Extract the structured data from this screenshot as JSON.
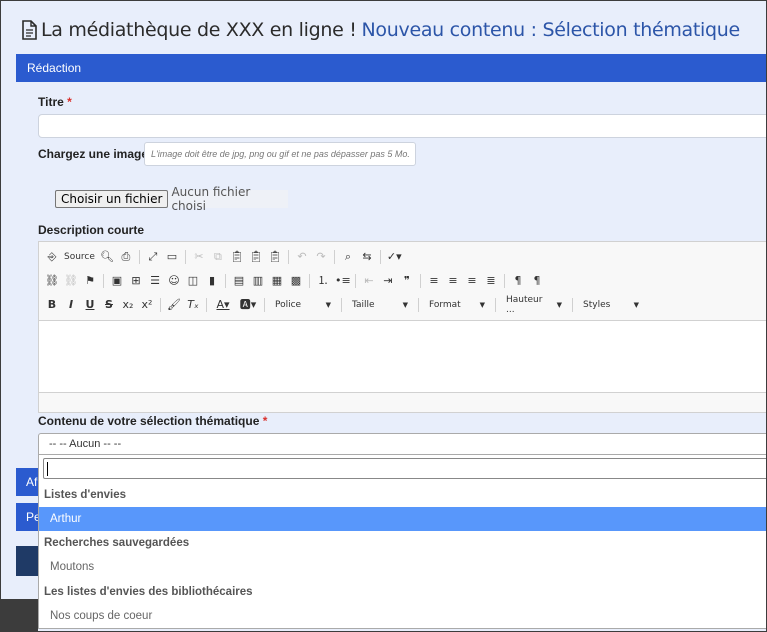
{
  "header": {
    "site_title": "La médiathèque de XXX en ligne !",
    "breadcrumb": "Nouveau contenu : Sélection thématique"
  },
  "section": {
    "title": "Rédaction"
  },
  "form": {
    "titre_label": "Titre",
    "required_mark": "*",
    "image_label": "Chargez une image",
    "image_hint": "L'image doit être de jpg, png ou gif et ne pas dépasser pas 5 Mo.",
    "file_button": "Choisir un fichier",
    "file_status": "Aucun fichier choisi",
    "description_label": "Description courte",
    "content_label": "Contenu de votre sélection thématique"
  },
  "editor_toolbar": {
    "source_label": "Source",
    "combos": [
      "Police",
      "Taille",
      "Format",
      "Hauteur ...",
      "Styles"
    ]
  },
  "select": {
    "current_value": "-- -- Aucun -- --",
    "groups": [
      {
        "label": "Listes d'envies",
        "options": [
          {
            "label": "Arthur",
            "selected": true
          }
        ]
      },
      {
        "label": "Recherches sauvegardées",
        "options": [
          {
            "label": "Moutons",
            "selected": false
          }
        ]
      },
      {
        "label": "Les listes d'envies des bibliothécaires",
        "options": [
          {
            "label": "Nos coups de coeur",
            "selected": false
          }
        ]
      }
    ]
  },
  "side_tabs": [
    "Af",
    "Pe"
  ],
  "colors": {
    "accent": "#2b5bcf",
    "highlight": "#5897fb",
    "required": "#d9302c",
    "page_bg": "#e8eefb"
  }
}
